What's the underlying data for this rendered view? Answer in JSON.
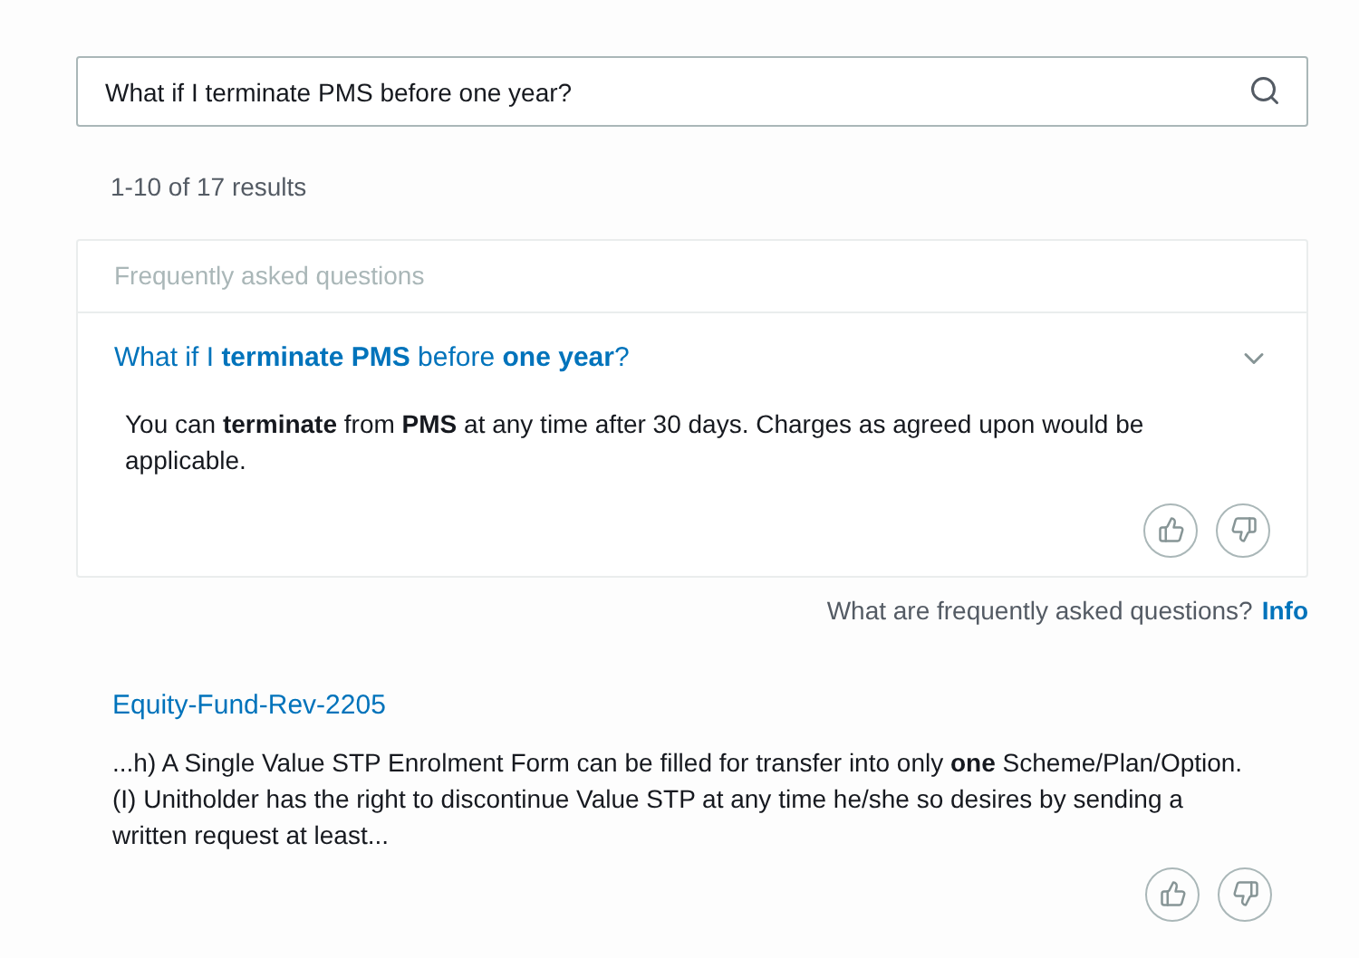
{
  "search": {
    "value": "What if I terminate PMS before one year?"
  },
  "results_count": "1-10 of 17 results",
  "faq": {
    "header": "Frequently asked questions",
    "items": [
      {
        "question": "What if I **terminate PMS** before **one year**?",
        "expanded": true,
        "answer": "You can **terminate** from **PMS** at any time after 30 days. Charges as agreed upon would be applicable."
      }
    ],
    "info_text": "What are frequently asked questions?",
    "info_link": "Info"
  },
  "results": [
    {
      "title": "Equity-Fund-Rev-2205",
      "excerpt": "...h) A Single Value STP Enrolment Form can be filled for transfer into only **one** Scheme/Plan/Option.\n(I) Unitholder has the right to discontinue Value STP at any time he/she so desires by sending a written request at least..."
    }
  ]
}
